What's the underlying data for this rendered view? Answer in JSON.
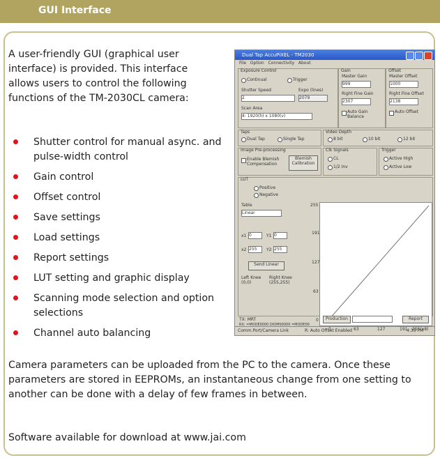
{
  "header": {
    "title": "GUI Interface"
  },
  "intro": "A user-friendly GUI (graphical user interface) is provided. This interface allows users to control the following functions of the TM-2030CL camera:",
  "features": [
    "Shutter control for manual async. and pulse-width control",
    "Gain control",
    "Offset control",
    "Save settings",
    "Load settings",
    "Report settings",
    "LUT setting and graphic display",
    "Scanning mode selection and option selections",
    "Channel auto balancing"
  ],
  "paragraph": "Camera parameters can be uploaded from the PC to the camera. Once these parameters are stored in EEPROMs, an instantaneous change from one setting to another can be done with a delay of few frames in between.",
  "download": "Software available for download at www.jai.com",
  "gui": {
    "title": "Dual Tap AccuPiXEL - TM2030",
    "menu": [
      "File",
      "Option",
      "Connectivity",
      "About"
    ],
    "exposure": {
      "group": "Exposure Control",
      "continuous": "Continual",
      "trigger": "Trigger",
      "shutter_label": "Shutter Speed",
      "shutter_value": "2",
      "expo_label": "Expo (lines)",
      "expo_value": "2079",
      "scan_label": "Scan Area",
      "scan_value": "4: 1920(h) x 1080(v)"
    },
    "gain": {
      "group": "Gain",
      "master_label": "Master Gain",
      "master_value": "999",
      "fine_label": "Right Fine Gain",
      "fine_value": "2307",
      "auto_label": "Auto Gain Balance"
    },
    "offset": {
      "group": "Offset",
      "master_label": "Master Offset",
      "master_value": "1000",
      "fine_label": "Right Fine Offset",
      "fine_value": "2138",
      "auto_label": "Auto Offset"
    },
    "taps": {
      "group": "Taps",
      "dual": "Dual Tap",
      "single": "Single Tap"
    },
    "video_depth": {
      "group": "Video Depth",
      "opt8": "8 bit",
      "opt10": "10 bit",
      "opt12": "12 bit"
    },
    "preprocess": {
      "group": "Image Pre-processing",
      "enable": "Enable Blemish Compensation",
      "calibrate": "Blemish Calibration"
    },
    "clk": {
      "group": "Clk Signals",
      "opt1": "CL",
      "opt2": "1/2 Inv"
    },
    "trigger": {
      "group": "Trigger",
      "high": "Active High",
      "low": "Active Low"
    },
    "lut": {
      "group": "LUT",
      "positive": "Positive",
      "negative": "Negative",
      "table_label": "Table",
      "table_value": "Linear",
      "x1_label": "x1",
      "x1": "0",
      "y1_label": "Y1",
      "y1": "0",
      "x2_label": "x2",
      "x2": "255",
      "y2_label": "Y2",
      "y2": "255",
      "send": "Send Linear",
      "left_knee": "Left Knee (0,0)",
      "right_knee": "Right Knee (255,255)",
      "y_ticks": [
        "255",
        "191",
        "127",
        "63",
        "0"
      ],
      "x_ticks": [
        "0",
        "63",
        "127",
        "191",
        "255(x8)"
      ]
    },
    "bottom": {
      "tx": "TX: MRT",
      "rx": "RX: =MODE0000 DIOMS0000 =MODE00",
      "production": "Production",
      "report": "Report"
    },
    "status": {
      "port": "Comm.Port/Camera Link",
      "msg": "R: Auto Offset Enabled",
      "time": "4:33 PM"
    }
  }
}
